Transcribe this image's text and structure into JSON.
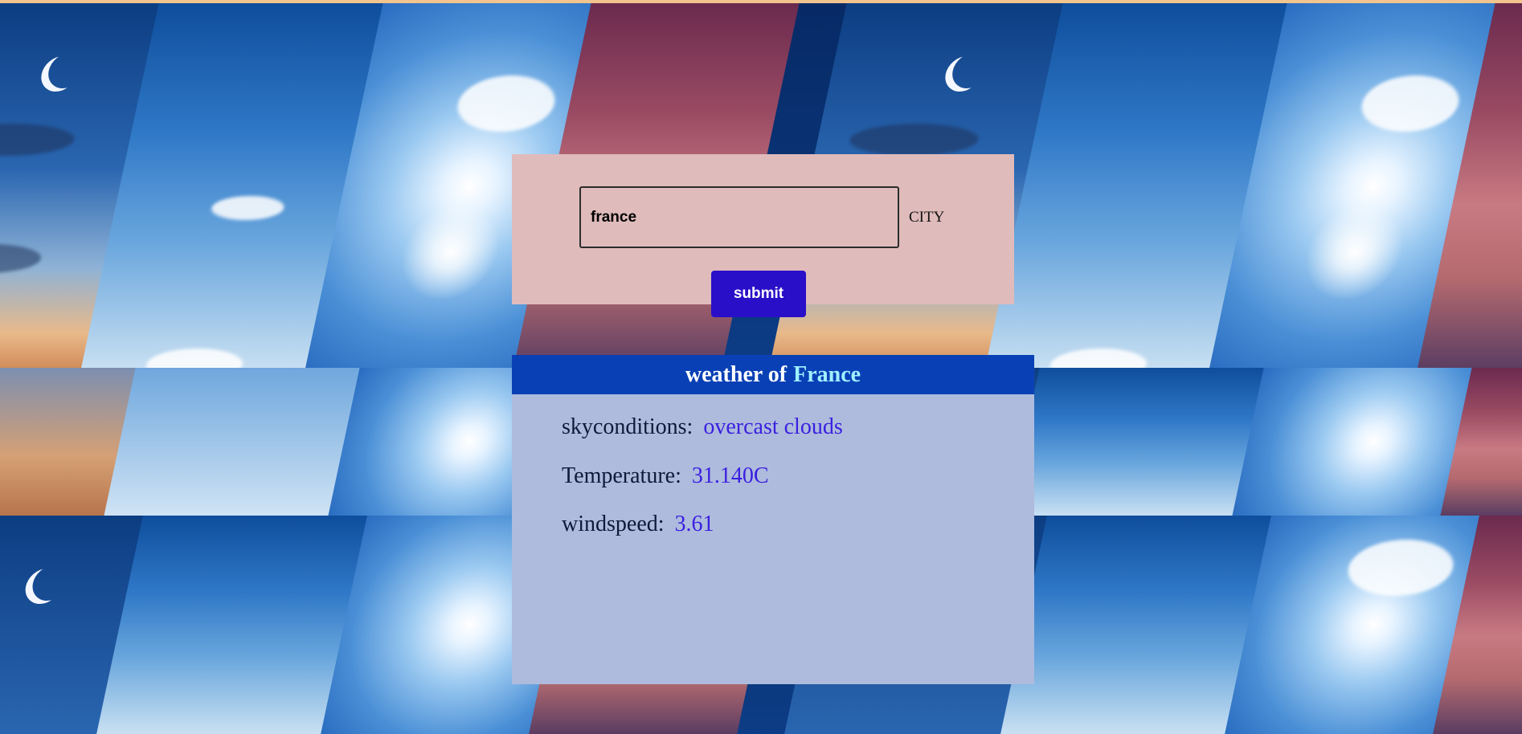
{
  "form": {
    "city_input_value": "france",
    "city_label": "CITY",
    "submit_label": "submit"
  },
  "results": {
    "header_prefix": "weather of",
    "header_city": "France",
    "sky_label": "skyconditions:",
    "sky_value": "overcast clouds",
    "temp_label": "Temperature:",
    "temp_value": "31.140C",
    "wind_label": "windspeed:",
    "wind_value": "3.61"
  },
  "colors": {
    "form_bg": "#e0bbbb",
    "submit_bg": "#2a0fc9",
    "results_bg": "#aebbdd",
    "header_bg": "#0a40b6",
    "header_city": "#9ff0ff",
    "value_text": "#3a1fe0"
  },
  "background": {
    "description_icons": [
      "moon-icon",
      "sun-icon",
      "cloud-icon"
    ]
  }
}
